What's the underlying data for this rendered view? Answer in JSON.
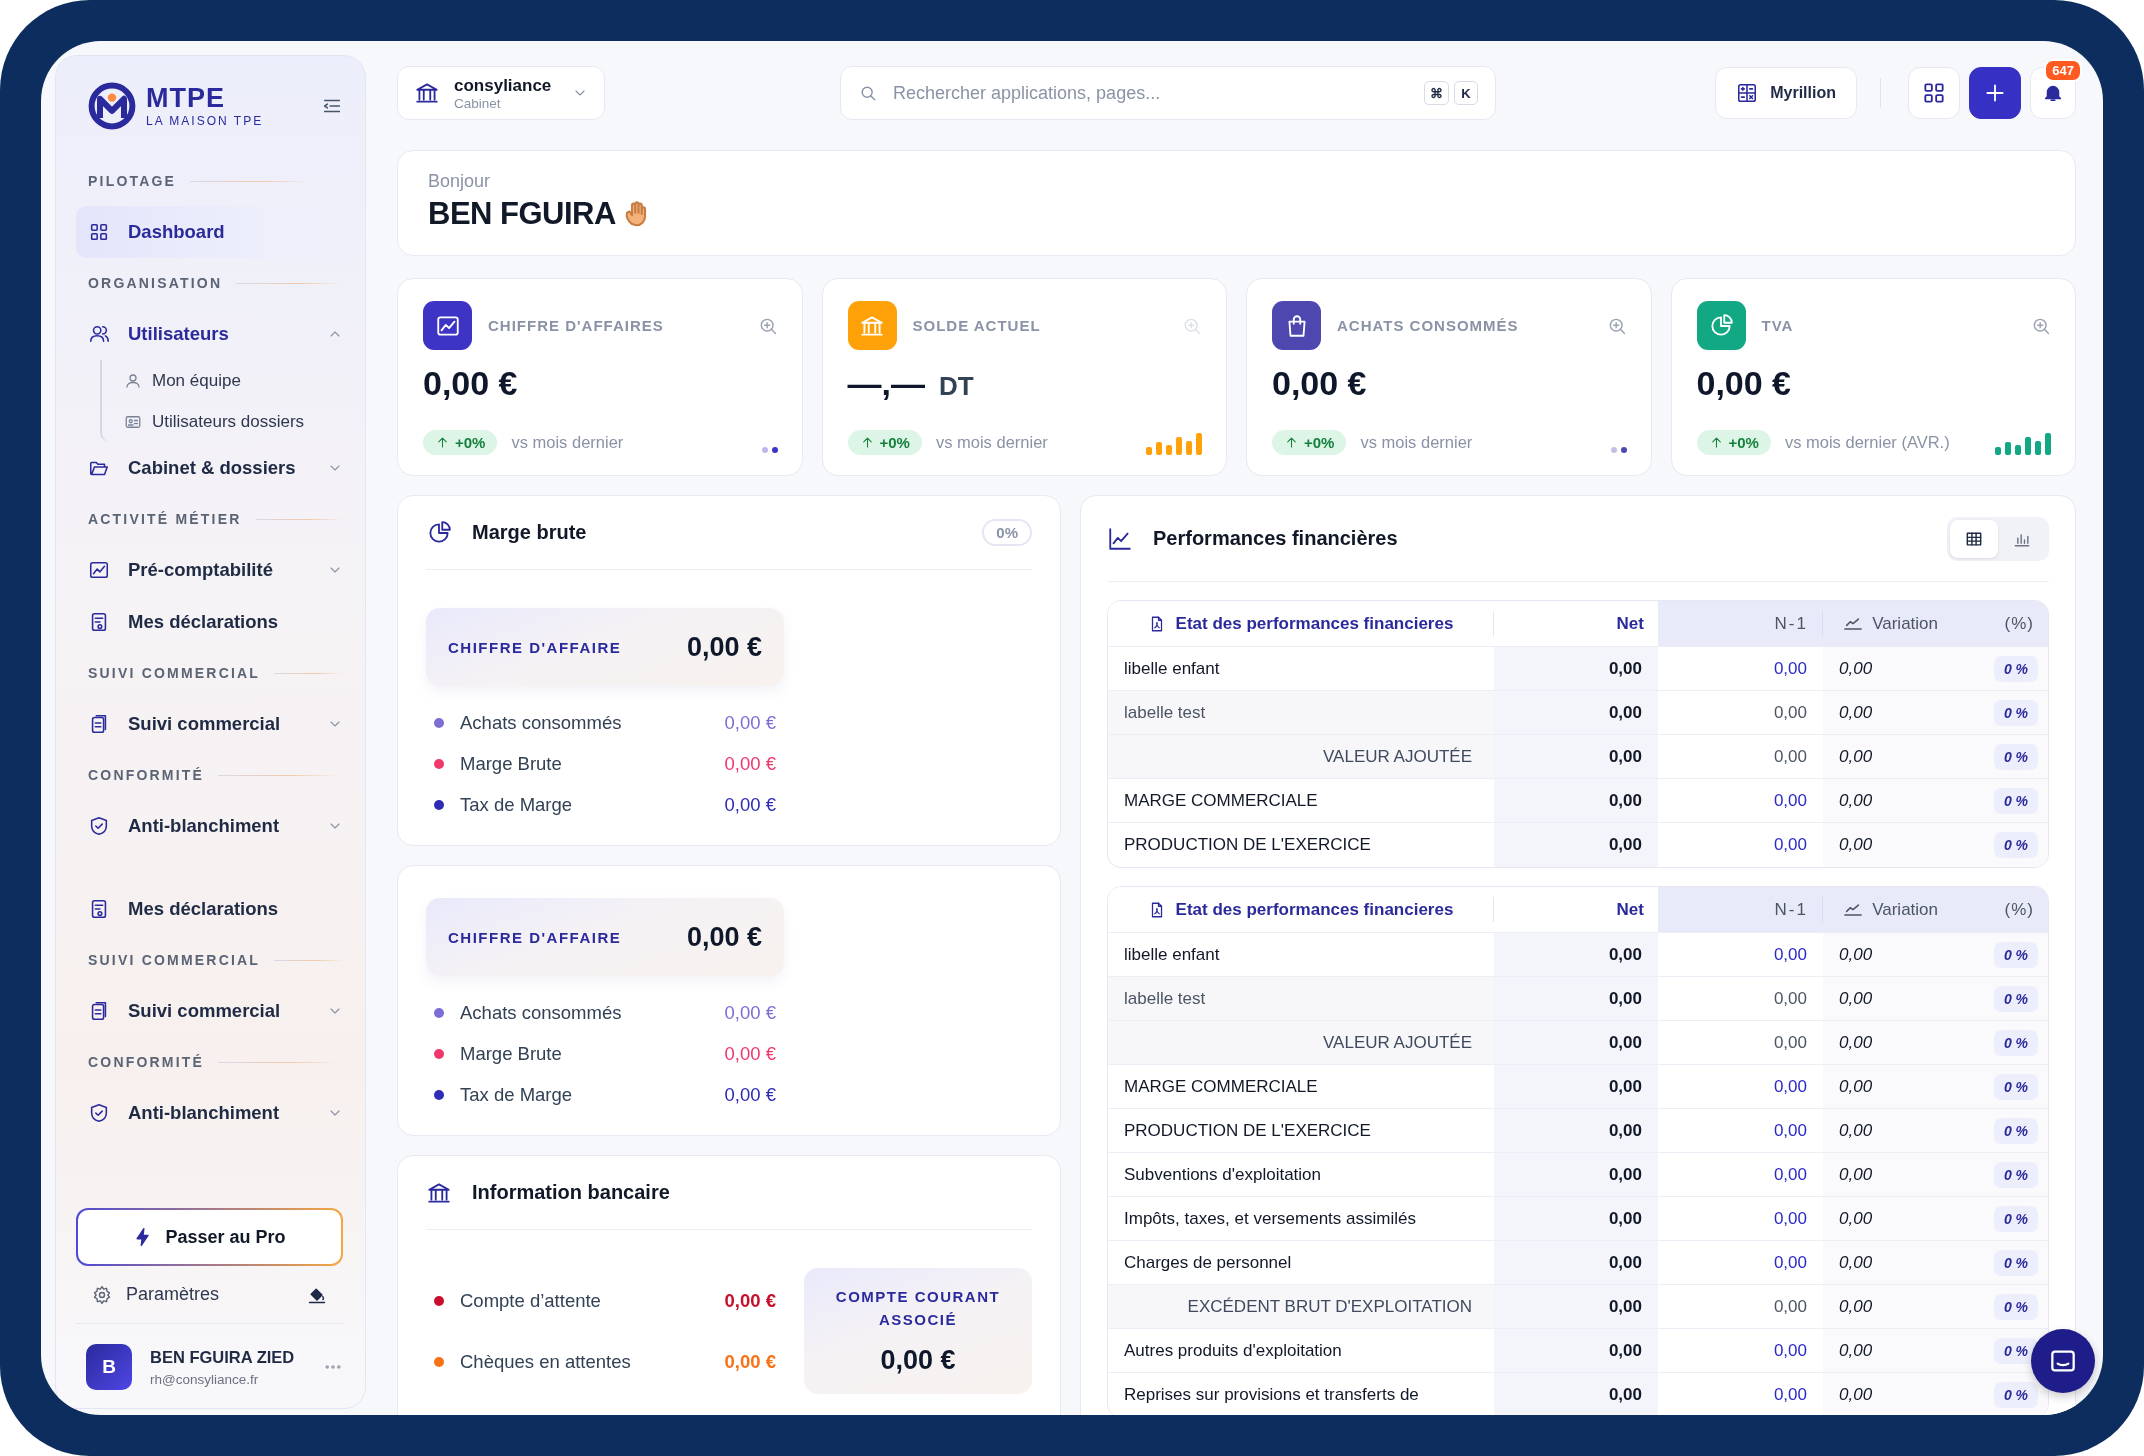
{
  "sidebar": {
    "logo": {
      "name": "MTPE",
      "tagline": "LA MAISON TPE"
    },
    "groups": [
      [
        {
          "kind": "section",
          "label": "PILOTAGE"
        },
        {
          "kind": "item",
          "label": "Dashboard",
          "selected": true
        },
        {
          "kind": "section",
          "label": "ORGANISATION"
        },
        {
          "kind": "item",
          "label": "Utilisateurs",
          "selected": false,
          "expanded": true,
          "children": [
            {
              "label": "Mon équipe",
              "selected": false
            },
            {
              "label": "Utilisateurs dossiers",
              "selected": false
            }
          ]
        },
        {
          "kind": "item",
          "label": "Cabinet & dossiers",
          "selected": false,
          "expanded": false
        },
        {
          "kind": "section",
          "label": "ACTIVITÉ MÉTIER"
        },
        {
          "kind": "item",
          "label": "Pré-comptabilité",
          "selected": false,
          "expanded": false
        },
        {
          "kind": "item",
          "label": "Mes déclarations",
          "selected": false
        },
        {
          "kind": "section",
          "label": "SUIVI COMMERCIAL"
        },
        {
          "kind": "item",
          "label": "Suivi commercial",
          "selected": false,
          "expanded": false
        },
        {
          "kind": "section",
          "label": "CONFORMITÉ"
        },
        {
          "kind": "item",
          "label": "Anti-blanchiment",
          "selected": false,
          "expanded": false
        }
      ],
      [
        {
          "kind": "item",
          "label": "Mes déclarations",
          "selected": false
        },
        {
          "kind": "section",
          "label": "SUIVI COMMERCIAL"
        },
        {
          "kind": "item",
          "label": "Suivi commercial",
          "selected": false,
          "expanded": false
        },
        {
          "kind": "section",
          "label": "CONFORMITÉ"
        },
        {
          "kind": "item",
          "label": "Anti-blanchiment",
          "selected": false,
          "expanded": false
        }
      ]
    ],
    "upgrade_button": "Passer au Pro",
    "settings": "Paramètres",
    "user": {
      "initial": "B",
      "name": "BEN FGUIRA ZIED",
      "email": "rh@consyliance.fr"
    }
  },
  "header": {
    "organization": {
      "name": "consyliance",
      "type": "Cabinet"
    },
    "search": {
      "placeholder": "Rechercher applications, pages...",
      "shortcut": [
        "⌘",
        "K"
      ]
    },
    "company_button": "Myrillion",
    "notification_count": "647"
  },
  "greeting": {
    "hello": "Bonjour",
    "name": "BEN FGUIRA"
  },
  "kpis": [
    {
      "title": "CHIFFRE D'AFFAIRES",
      "value": "0,00 €",
      "change": "+0%",
      "caption": "vs mois dernier",
      "color": "#3d33c4",
      "kind": "dots",
      "zoom_disabled": false
    },
    {
      "title": "SOLDE ACTUEL",
      "value": "—,—",
      "unit": "DT",
      "change": "+0%",
      "caption": "vs mois dernier",
      "color": "#ffa20a",
      "kind": "bars",
      "zoom_disabled": true
    },
    {
      "title": "ACHATS CONSOMMÉS",
      "value": "0,00 €",
      "change": "+0%",
      "caption": "vs mois dernier",
      "color": "#4f47b0",
      "kind": "dots",
      "zoom_disabled": false
    },
    {
      "title": "TVA",
      "value": "0,00 €",
      "change": "+0%",
      "caption": "vs mois dernier (AVR.)",
      "color": "#12a884",
      "kind": "bars",
      "zoom_disabled": false
    }
  ],
  "margin_cards": [
    {
      "title": "Marge brute",
      "badge": "0%",
      "summary": {
        "label": "CHIFFRE D'AFFAIRE",
        "value": "0,00 €"
      },
      "items": [
        {
          "label": "Achats consommés",
          "value": "0,00 €",
          "color": "#7b6fd6"
        },
        {
          "label": "Marge Brute",
          "value": "0,00 €",
          "color": "#f0386b"
        },
        {
          "label": "Tax de Marge",
          "value": "0,00 €",
          "color": "#2f2bb5"
        }
      ]
    },
    {
      "summary": {
        "label": "CHIFFRE D'AFFAIRE",
        "value": "0,00 €"
      },
      "items": [
        {
          "label": "Achats consommés",
          "value": "0,00 €",
          "color": "#7b6fd6"
        },
        {
          "label": "Marge Brute",
          "value": "0,00 €",
          "color": "#f0386b"
        },
        {
          "label": "Tax de Marge",
          "value": "0,00 €",
          "color": "#2f2bb5"
        }
      ]
    }
  ],
  "bank": {
    "title": "Information bancaire",
    "items": [
      {
        "label": "Compte d’attente",
        "value": "0,00 €",
        "color": "#c8102e"
      },
      {
        "label": "Chèques en attentes",
        "value": "0,00 €",
        "color": "#f97316"
      }
    ],
    "associate_account": {
      "label": "COMPTE COURANT ASSOCIÉ",
      "value": "0,00 €"
    }
  },
  "performance": {
    "title": "Performances financières",
    "views": [
      {
        "kind": "table",
        "selected": true
      },
      {
        "kind": "chart",
        "selected": false
      }
    ],
    "tables": [
      {
        "columns": [
          "Etat des performances financieres",
          "Net",
          "N-1",
          "Variation",
          "(%)"
        ],
        "rows": [
          {
            "kind": "item",
            "label": "libelle enfant",
            "net": "0,00",
            "n1": "0,00",
            "variation": "0,00",
            "pct": "0 %"
          },
          {
            "kind": "muted",
            "label": "labelle test",
            "net": "0,00",
            "n1": "0,00",
            "variation": "0,00",
            "pct": "0 %"
          },
          {
            "kind": "total",
            "label": "VALEUR AJOUTÉE",
            "net": "0,00",
            "n1": "0,00",
            "variation": "0,00",
            "pct": "0 %"
          },
          {
            "kind": "item",
            "label": "MARGE COMMERCIALE",
            "net": "0,00",
            "n1": "0,00",
            "variation": "0,00",
            "pct": "0 %"
          },
          {
            "kind": "item",
            "label": "PRODUCTION DE L'EXERCICE",
            "net": "0,00",
            "n1": "0,00",
            "variation": "0,00",
            "pct": "0 %"
          }
        ]
      },
      {
        "columns": [
          "Etat des performances financieres",
          "Net",
          "N-1",
          "Variation",
          "(%)"
        ],
        "rows": [
          {
            "kind": "item",
            "label": "libelle enfant",
            "net": "0,00",
            "n1": "0,00",
            "variation": "0,00",
            "pct": "0 %"
          },
          {
            "kind": "muted",
            "label": "labelle test",
            "net": "0,00",
            "n1": "0,00",
            "variation": "0,00",
            "pct": "0 %"
          },
          {
            "kind": "total",
            "label": "VALEUR AJOUTÉE",
            "net": "0,00",
            "n1": "0,00",
            "variation": "0,00",
            "pct": "0 %"
          },
          {
            "kind": "item",
            "label": "MARGE COMMERCIALE",
            "net": "0,00",
            "n1": "0,00",
            "variation": "0,00",
            "pct": "0 %"
          },
          {
            "kind": "item",
            "label": "PRODUCTION DE L'EXERCICE",
            "net": "0,00",
            "n1": "0,00",
            "variation": "0,00",
            "pct": "0 %"
          },
          {
            "kind": "item",
            "label": "Subventions d'exploitation",
            "net": "0,00",
            "n1": "0,00",
            "variation": "0,00",
            "pct": "0 %"
          },
          {
            "kind": "item",
            "label": "Impôts, taxes, et versements assimilés",
            "net": "0,00",
            "n1": "0,00",
            "variation": "0,00",
            "pct": "0 %"
          },
          {
            "kind": "item",
            "label": "Charges de personnel",
            "net": "0,00",
            "n1": "0,00",
            "variation": "0,00",
            "pct": "0 %"
          },
          {
            "kind": "total",
            "label": "EXCÉDENT BRUT D'EXPLOITATION",
            "net": "0,00",
            "n1": "0,00",
            "variation": "0,00",
            "pct": "0 %"
          },
          {
            "kind": "item",
            "label": "Autres produits d'exploitation",
            "net": "0,00",
            "n1": "0,00",
            "variation": "0,00",
            "pct": "0 %"
          },
          {
            "kind": "item",
            "label": "Reprises sur provisions et transferts de",
            "net": "0,00",
            "n1": "0,00",
            "variation": "0,00",
            "pct": "0 %"
          }
        ]
      }
    ]
  }
}
